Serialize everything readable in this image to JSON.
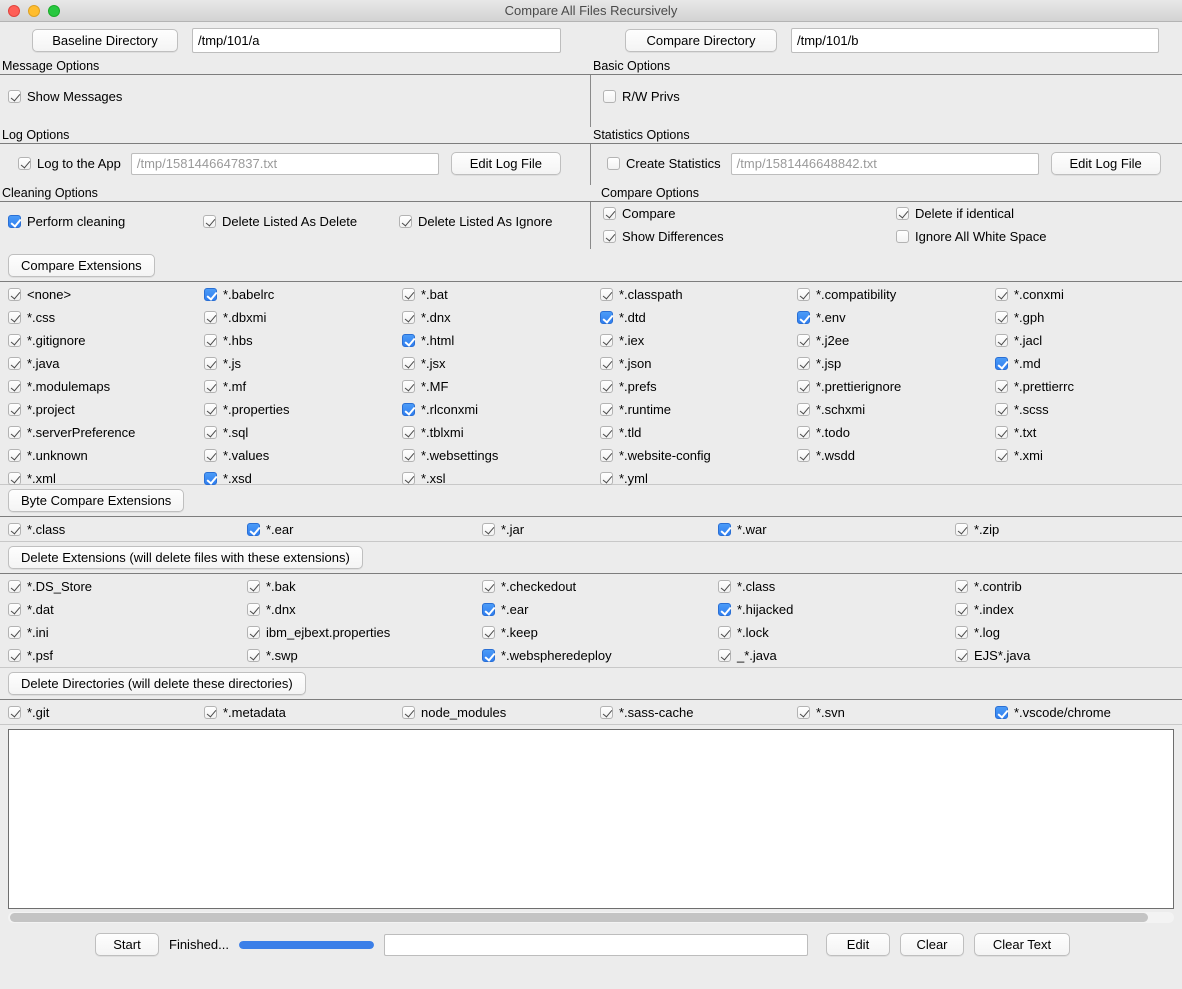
{
  "window": {
    "title": "Compare All Files Recursively",
    "traffic_lights": [
      "close-light",
      "minimize-light",
      "maximize-light"
    ]
  },
  "directories": {
    "baseline_button": "Baseline Directory",
    "baseline_value": "/tmp/101/a",
    "compare_button": "Compare Directory",
    "compare_value": "/tmp/101/b"
  },
  "message_options": {
    "title": "Message Options",
    "show_messages": {
      "label": "Show Messages",
      "checked": true,
      "highlighted": false
    }
  },
  "basic_options": {
    "title": "Basic Options",
    "rw_privs": {
      "label": "R/W Privs",
      "checked": false,
      "highlighted": false
    }
  },
  "log_options": {
    "title": "Log Options",
    "log_to_app": {
      "label": "Log to the App",
      "checked": true,
      "highlighted": false
    },
    "log_file_placeholder": "/tmp/1581446647837.txt",
    "edit_log_button": "Edit Log File"
  },
  "statistics_options": {
    "title": "Statistics Options",
    "create_statistics": {
      "label": "Create Statistics",
      "checked": false,
      "highlighted": false
    },
    "stats_file_placeholder": "/tmp/1581446648842.txt",
    "edit_log_button": "Edit Log File"
  },
  "cleaning_options": {
    "title": "Cleaning Options",
    "items": [
      {
        "label": "Perform cleaning",
        "checked": true,
        "highlighted": true
      },
      {
        "label": "Delete Listed As Delete",
        "checked": true,
        "highlighted": false
      },
      {
        "label": "Delete Listed As Ignore",
        "checked": true,
        "highlighted": false
      }
    ]
  },
  "compare_options": {
    "title": "Compare Options",
    "items": [
      {
        "label": "Compare",
        "checked": true,
        "highlighted": false
      },
      {
        "label": "Delete if identical",
        "checked": true,
        "highlighted": false
      },
      {
        "label": "Show Differences",
        "checked": true,
        "highlighted": false
      },
      {
        "label": "Ignore All White Space",
        "checked": false,
        "highlighted": false
      }
    ]
  },
  "compare_extensions": {
    "button_label": "Compare Extensions",
    "columns": 6,
    "items": [
      {
        "label": "<none>",
        "checked": true,
        "highlighted": false
      },
      {
        "label": "*.babelrc",
        "checked": true,
        "highlighted": true
      },
      {
        "label": "*.bat",
        "checked": true,
        "highlighted": false
      },
      {
        "label": "*.classpath",
        "checked": true,
        "highlighted": false
      },
      {
        "label": "*.compatibility",
        "checked": true,
        "highlighted": false
      },
      {
        "label": "*.conxmi",
        "checked": true,
        "highlighted": false
      },
      {
        "label": "*.css",
        "checked": true,
        "highlighted": false
      },
      {
        "label": "*.dbxmi",
        "checked": true,
        "highlighted": false
      },
      {
        "label": "*.dnx",
        "checked": true,
        "highlighted": false
      },
      {
        "label": "*.dtd",
        "checked": true,
        "highlighted": true
      },
      {
        "label": "*.env",
        "checked": true,
        "highlighted": true
      },
      {
        "label": "*.gph",
        "checked": true,
        "highlighted": false
      },
      {
        "label": "*.gitignore",
        "checked": true,
        "highlighted": false
      },
      {
        "label": "*.hbs",
        "checked": true,
        "highlighted": false
      },
      {
        "label": "*.html",
        "checked": true,
        "highlighted": true
      },
      {
        "label": "*.iex",
        "checked": true,
        "highlighted": false
      },
      {
        "label": "*.j2ee",
        "checked": true,
        "highlighted": false
      },
      {
        "label": "*.jacl",
        "checked": true,
        "highlighted": false
      },
      {
        "label": "*.java",
        "checked": true,
        "highlighted": false
      },
      {
        "label": "*.js",
        "checked": true,
        "highlighted": false
      },
      {
        "label": "*.jsx",
        "checked": true,
        "highlighted": false
      },
      {
        "label": "*.json",
        "checked": true,
        "highlighted": false
      },
      {
        "label": "*.jsp",
        "checked": true,
        "highlighted": false
      },
      {
        "label": "*.md",
        "checked": true,
        "highlighted": true
      },
      {
        "label": "*.modulemaps",
        "checked": true,
        "highlighted": false
      },
      {
        "label": "*.mf",
        "checked": true,
        "highlighted": false
      },
      {
        "label": "*.MF",
        "checked": true,
        "highlighted": false
      },
      {
        "label": "*.prefs",
        "checked": true,
        "highlighted": false
      },
      {
        "label": "*.prettierignore",
        "checked": true,
        "highlighted": false
      },
      {
        "label": "*.prettierrc",
        "checked": true,
        "highlighted": false
      },
      {
        "label": "*.project",
        "checked": true,
        "highlighted": false
      },
      {
        "label": "*.properties",
        "checked": true,
        "highlighted": false
      },
      {
        "label": "*.rlconxmi",
        "checked": true,
        "highlighted": true
      },
      {
        "label": "*.runtime",
        "checked": true,
        "highlighted": false
      },
      {
        "label": "*.schxmi",
        "checked": true,
        "highlighted": false
      },
      {
        "label": "*.scss",
        "checked": true,
        "highlighted": false
      },
      {
        "label": "*.serverPreference",
        "checked": true,
        "highlighted": false
      },
      {
        "label": "*.sql",
        "checked": true,
        "highlighted": false
      },
      {
        "label": "*.tblxmi",
        "checked": true,
        "highlighted": false
      },
      {
        "label": "*.tld",
        "checked": true,
        "highlighted": false
      },
      {
        "label": "*.todo",
        "checked": true,
        "highlighted": false
      },
      {
        "label": "*.txt",
        "checked": true,
        "highlighted": false
      },
      {
        "label": "*.unknown",
        "checked": true,
        "highlighted": false
      },
      {
        "label": "*.values",
        "checked": true,
        "highlighted": false
      },
      {
        "label": "*.websettings",
        "checked": true,
        "highlighted": false
      },
      {
        "label": "*.website-config",
        "checked": true,
        "highlighted": false
      },
      {
        "label": "*.wsdd",
        "checked": true,
        "highlighted": false
      },
      {
        "label": "*.xmi",
        "checked": true,
        "highlighted": false
      },
      {
        "label": "*.xml",
        "checked": true,
        "highlighted": false
      },
      {
        "label": "*.xsd",
        "checked": true,
        "highlighted": true
      },
      {
        "label": "*.xsl",
        "checked": true,
        "highlighted": false
      },
      {
        "label": "*.yml",
        "checked": true,
        "highlighted": false
      }
    ]
  },
  "byte_compare_extensions": {
    "button_label": "Byte Compare Extensions",
    "columns": 5,
    "items": [
      {
        "label": "*.class",
        "checked": true,
        "highlighted": false
      },
      {
        "label": "*.ear",
        "checked": true,
        "highlighted": true
      },
      {
        "label": "*.jar",
        "checked": true,
        "highlighted": false
      },
      {
        "label": "*.war",
        "checked": true,
        "highlighted": true
      },
      {
        "label": "*.zip",
        "checked": true,
        "highlighted": false
      }
    ]
  },
  "delete_extensions": {
    "button_label": "Delete Extensions (will delete files with these extensions)",
    "columns": 5,
    "items": [
      {
        "label": "*.DS_Store",
        "checked": true,
        "highlighted": false
      },
      {
        "label": "*.bak",
        "checked": true,
        "highlighted": false
      },
      {
        "label": "*.checkedout",
        "checked": true,
        "highlighted": false
      },
      {
        "label": "*.class",
        "checked": true,
        "highlighted": false
      },
      {
        "label": "*.contrib",
        "checked": true,
        "highlighted": false
      },
      {
        "label": "*.dat",
        "checked": true,
        "highlighted": false
      },
      {
        "label": "*.dnx",
        "checked": true,
        "highlighted": false
      },
      {
        "label": "*.ear",
        "checked": true,
        "highlighted": true
      },
      {
        "label": "*.hijacked",
        "checked": true,
        "highlighted": true
      },
      {
        "label": "*.index",
        "checked": true,
        "highlighted": false
      },
      {
        "label": "*.ini",
        "checked": true,
        "highlighted": false
      },
      {
        "label": "ibm_ejbext.properties",
        "checked": true,
        "highlighted": false
      },
      {
        "label": "*.keep",
        "checked": true,
        "highlighted": false
      },
      {
        "label": "*.lock",
        "checked": true,
        "highlighted": false
      },
      {
        "label": "*.log",
        "checked": true,
        "highlighted": false
      },
      {
        "label": "*.psf",
        "checked": true,
        "highlighted": false
      },
      {
        "label": "*.swp",
        "checked": true,
        "highlighted": false
      },
      {
        "label": "*.webspheredeploy",
        "checked": true,
        "highlighted": true
      },
      {
        "label": "_*.java",
        "checked": true,
        "highlighted": false
      },
      {
        "label": "EJS*.java",
        "checked": true,
        "highlighted": false
      }
    ]
  },
  "delete_directories": {
    "button_label": "Delete Directories (will delete these directories)",
    "columns": 6,
    "items": [
      {
        "label": "*.git",
        "checked": true,
        "highlighted": false
      },
      {
        "label": "*.metadata",
        "checked": true,
        "highlighted": false
      },
      {
        "label": "node_modules",
        "checked": true,
        "highlighted": false
      },
      {
        "label": "*.sass-cache",
        "checked": true,
        "highlighted": false
      },
      {
        "label": "*.svn",
        "checked": true,
        "highlighted": false
      },
      {
        "label": "*.vscode/chrome",
        "checked": true,
        "highlighted": true
      }
    ]
  },
  "output": {
    "text": ""
  },
  "bottom_bar": {
    "start_button": "Start",
    "status": "Finished...",
    "progress_percent": 100,
    "input_value": "",
    "edit_button": "Edit",
    "clear_button": "Clear",
    "clear_text_button": "Clear Text"
  },
  "colors": {
    "accent": "#3b7fe8",
    "checkbox_on": "#2f7ef0",
    "window_bg": "#ececec",
    "separator": "#7d7d7d"
  }
}
